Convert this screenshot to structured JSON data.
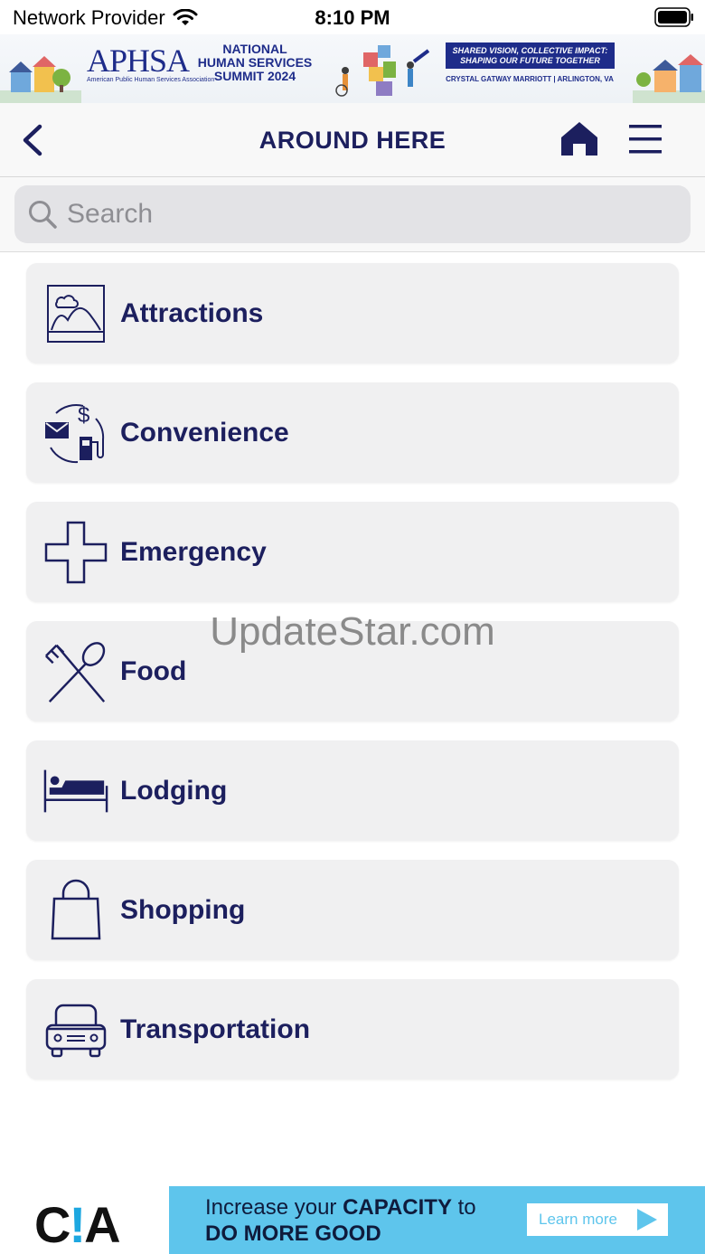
{
  "status_bar": {
    "carrier": "Network Provider",
    "time": "8:10 PM"
  },
  "banner": {
    "logo": "APHSA",
    "logo_sub": "American Public Human Services Association",
    "summit_line1": "NATIONAL",
    "summit_line2": "HUMAN SERVICES",
    "summit_line3": "SUMMIT 2024",
    "tagline_line1": "SHARED VISION, COLLECTIVE IMPACT:",
    "tagline_line2": "SHAPING OUR FUTURE TOGETHER",
    "venue": "CRYSTAL GATWAY MARRIOTT  |  ARLINGTON, VA"
  },
  "navbar": {
    "title": "AROUND HERE"
  },
  "search": {
    "placeholder": "Search"
  },
  "categories": [
    {
      "label": "Attractions",
      "icon": "attractions-icon"
    },
    {
      "label": "Convenience",
      "icon": "convenience-icon"
    },
    {
      "label": "Emergency",
      "icon": "emergency-cross-icon"
    },
    {
      "label": "Food",
      "icon": "fork-spoon-icon"
    },
    {
      "label": "Lodging",
      "icon": "bed-icon"
    },
    {
      "label": "Shopping",
      "icon": "shopping-bag-icon"
    },
    {
      "label": "Transportation",
      "icon": "car-icon"
    }
  ],
  "watermark": "UpdateStar.com",
  "ad": {
    "brand": "C!A",
    "line1_pre": "Increase your ",
    "line1_bold": "CAPACITY",
    "line1_post": " to",
    "line2": "DO MORE GOOD",
    "cta": "Learn more"
  },
  "colors": {
    "accent": "#1c1f5e",
    "card_bg": "#f0f0f1",
    "ad_bg": "#5ec5ec"
  }
}
